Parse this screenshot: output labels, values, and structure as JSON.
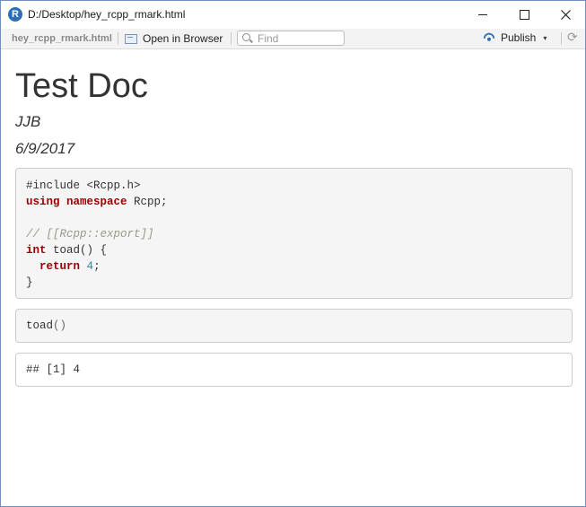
{
  "window": {
    "title": "D:/Desktop/hey_rcpp_rmark.html",
    "app_icon_letter": "R"
  },
  "toolbar": {
    "file_label": "hey_rcpp_rmark.html",
    "open_browser_label": "Open in Browser",
    "find_placeholder": "Find",
    "publish_label": "Publish",
    "publish_caret": "▾",
    "refresh_glyph": "⟳"
  },
  "document": {
    "title": "Test Doc",
    "author": "JJB",
    "date": "6/9/2017",
    "cpp_chunk": {
      "line1": "#include <Rcpp.h>",
      "line2_kw": "using namespace",
      "line2_rest": " Rcpp;",
      "line4_comment": "// [[Rcpp::export]]",
      "line5_kw": "int",
      "line5_rest": " toad() {",
      "line6_indent": "  ",
      "line6_kw": "return",
      "line6_space": " ",
      "line6_num": "4",
      "line6_end": ";",
      "line7": "}"
    },
    "r_chunk": {
      "fn": "toad",
      "parens": "()"
    },
    "output_chunk": {
      "text": "## [1] 4"
    }
  },
  "colors": {
    "keyword": "#990000",
    "comment": "#999988",
    "number": "#009999",
    "window_border": "#6e8fbf",
    "publish_blue": "#2d6fb7"
  }
}
